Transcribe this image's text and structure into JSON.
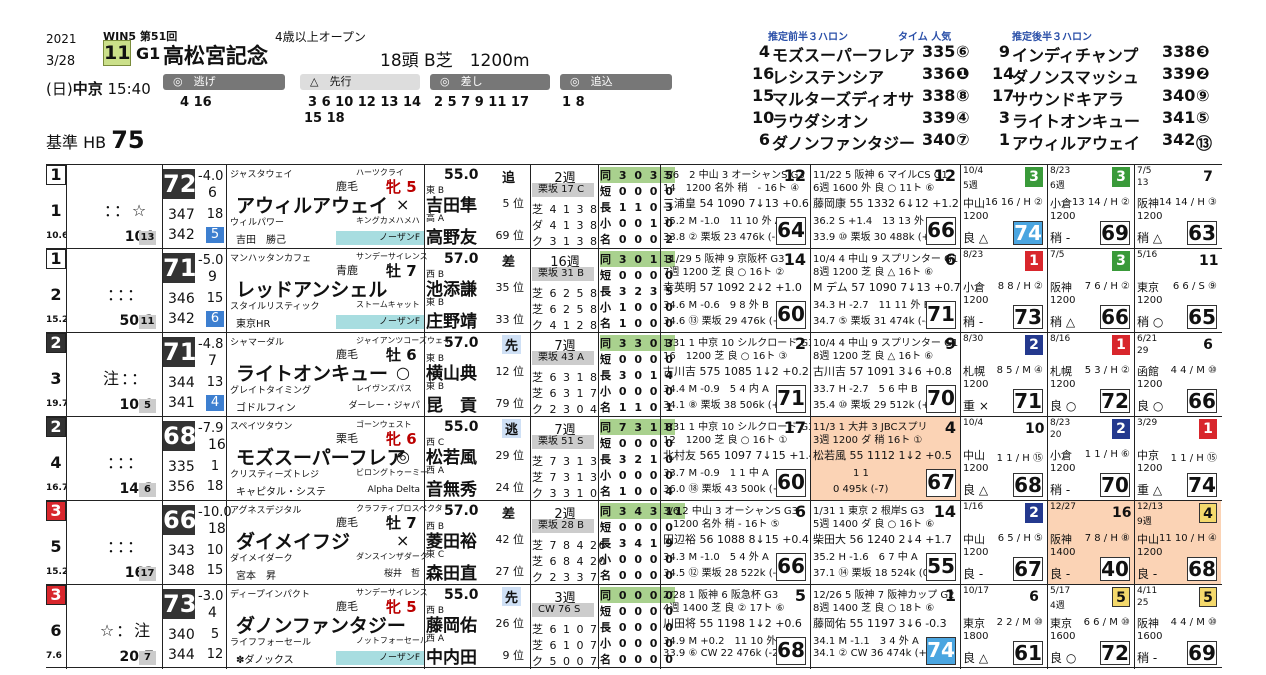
{
  "header": {
    "year": "2021",
    "date": "3/28",
    "day": "(日)",
    "venue": "中京",
    "time": "15:40",
    "race_no": "11",
    "grade": "G1",
    "race_name": "高松宮記念",
    "win5": "WIN5 第51回",
    "condition": "4歳以上オープン",
    "field": "18頭 B芝　1200m",
    "pace": [
      {
        "label": "逃げ",
        "horses": "4 16"
      },
      {
        "label": "先行",
        "horses": "3 6 10 12 13 14"
      },
      {
        "label": "先行2",
        "horses": "15 18"
      },
      {
        "label": "差し",
        "horses": "2 5 7 9 11 17"
      },
      {
        "label": "追込",
        "horses": "1 8"
      }
    ],
    "kijun_label": "基準 HB",
    "kijun_value": "75"
  },
  "predictions": {
    "front_hd": "推定前半３ハロン",
    "time_hd": "タイム 人気",
    "back_hd": "推定後半３ハロン",
    "front": [
      {
        "no": "4",
        "name": "モズスーパーフレア",
        "time": "335",
        "rank": "⑥"
      },
      {
        "no": "16",
        "name": "レシステンシア",
        "time": "336",
        "rank": "❶"
      },
      {
        "no": "15",
        "name": "マルターズディオサ",
        "time": "338",
        "rank": "⑧"
      },
      {
        "no": "10",
        "name": "ラウダシオン",
        "time": "339",
        "rank": "④"
      },
      {
        "no": "6",
        "name": "ダノンファンタジー",
        "time": "340",
        "rank": "⑦"
      }
    ],
    "back": [
      {
        "no": "9",
        "name": "インディチャンプ",
        "time": "338",
        "rank": "❸"
      },
      {
        "no": "14",
        "name": "ダノンスマッシュ",
        "time": "339",
        "rank": "❷"
      },
      {
        "no": "17",
        "name": "サウンドキアラ",
        "time": "340",
        "rank": "⑨"
      },
      {
        "no": "3",
        "name": "ライトオンキュー",
        "time": "341",
        "rank": "⑤"
      },
      {
        "no": "1",
        "name": "アウィルアウェイ",
        "time": "342",
        "rank": "⑬"
      }
    ]
  },
  "horses": [
    {
      "frame": "1",
      "num": "1",
      "odds_rank": "10.6",
      "marks": "：：☆",
      "odds": "104",
      "ninki": "13",
      "rating": "72",
      "rdiff": "-4.0",
      "rk": "6",
      "idx": [
        {
          "v": "347",
          "r": "18"
        },
        {
          "v": "342",
          "r": "5"
        }
      ],
      "sire": "ジャスタウェイ",
      "siresire": "ハーツクライ",
      "trainer": "鹿毛",
      "sex": "牝 5",
      "name": "アウィルアウェイ",
      "mark": "×",
      "dam": "ウィルパワー",
      "damsire": "キングカメハメハ",
      "owner": "吉田　勝己",
      "breeder": "ノーザンF",
      "wt": "55.0",
      "style": "追",
      "j1": "東 B",
      "jname1": "吉田隼",
      "jpos1": "5 位",
      "j2": "高 A",
      "jname2": "高野友",
      "jpos2": "69 位",
      "tr": "2週",
      "trbox": "栗坂 17 C",
      "tl1": "芝 4 1 3 8",
      "tl2": "ダ 4 1 3 8",
      "tl3": "ク 3 1 3 8",
      "st": [
        "同 3 0 3 5",
        "短 0 0 0 0",
        "長 1 1 0 3",
        "小 0 0 1 0",
        "名 0 0 0 2"
      ],
      "pr": [
        {
          "peach": false,
          "t1": "3/6　2 中山 3 オーシャンS G3",
          "fin": "12",
          "t2": "14　1200 名外 稍　- 16ト ④",
          "t3": "三浦皇 54 1090 7↓13 +0.6",
          "t4": "35.2 M -1.0　11 10 外 A",
          "t5": "33.8 ② 栗坂 23 476k (-12)",
          "tail": "64",
          "blue": false
        },
        {
          "peach": false,
          "t1": "11/22 5 阪神 6 マイルCS G1",
          "fin": "12",
          "t2": "6週 1600 外 良 ○ 11ト ⑥",
          "t3": "藤岡康 55 1332 6↓12 +1.2",
          "t4": "36.2 S +1.4　13 13 外 B",
          "t5": "33.9 ⑩ 栗坂 30 488k (+10)",
          "tail": "66",
          "blue": false
        }
      ],
      "sp": [
        {
          "d": "10/4",
          "f": "3",
          "fc": "green",
          "c": "5週",
          "v": "中山",
          "dist": "1200",
          "pos": "16 16 / H ②",
          "g": "良 △",
          "box": "74",
          "blue": true,
          "peach": false
        },
        {
          "d": "8/23",
          "f": "3",
          "fc": "green",
          "c": "6週",
          "v": "小倉",
          "dist": "1200",
          "pos": "13 14 / H ②",
          "g": "稍 -",
          "box": "69",
          "blue": false,
          "peach": false
        },
        {
          "d": "7/5",
          "f": "7",
          "fc": "plain",
          "c": "13",
          "v": "阪神",
          "dist": "1200",
          "pos": "14 14 / H ③",
          "g": "稍 △",
          "box": "63",
          "blue": false,
          "peach": false
        }
      ]
    },
    {
      "frame": "1",
      "num": "2",
      "odds_rank": "15.2",
      "marks": "：：：",
      "odds": "50.1",
      "ninki": "11",
      "rating": "71",
      "rdiff": "-5.0",
      "rk": "9",
      "idx": [
        {
          "v": "346",
          "r": "15"
        },
        {
          "v": "342",
          "r": "6"
        }
      ],
      "sire": "マンハッタンカフェ",
      "siresire": "サンデーサイレンス",
      "trainer": "青鹿",
      "sex": "牡 7",
      "name": "レッドアンシェル",
      "mark": "",
      "dam": "スタイルリスティック",
      "damsire": "ストームキャット",
      "owner": "東京HR",
      "breeder": "ノーザンF",
      "wt": "57.0",
      "style": "差",
      "j1": "西 B",
      "jname1": "池添謙",
      "jpos1": "35 位",
      "j2": "東 B",
      "jname2": "庄野靖",
      "jpos2": "33 位",
      "tr": "16週",
      "trbox": "栗坂 31 B",
      "tl1": "芝 6 2 5 8",
      "tl2": "芝 6 2 5 8",
      "tl3": "ク 4 1 2 8",
      "st": [
        "同 3 0 1 3",
        "短 0 0 0 0",
        "長 3 2 3 5",
        "小 1 0 0 0",
        "名 1 0 0 0"
      ],
      "pr": [
        {
          "peach": false,
          "t1": "11/29 5 阪神 9 京阪杯 G3",
          "fin": "14",
          "t2": "7週 1200 芝 良 ○ 16ト ②",
          "t3": "幸英明 57 1092 2↓2 +1.0",
          "t4": "34.6 M -0.6　9 8 外 B",
          "t5": "34.6 ⑬ 栗坂 29 476k (+2)",
          "tail": "60",
          "blue": false
        },
        {
          "peach": false,
          "t1": "10/4 4 中山 9 スプリンター G1",
          "fin": "6",
          "t2": "8週 1200 芝 良 △ 16ト ⑥",
          "t3": "M デム 57 1090 7↓13 +0.7",
          "t4": "34.3 H -2.7　11 11 外 B",
          "t5": "34.7 ⑤ 栗坂 31 474k (-4)",
          "tail": "71",
          "blue": false
        }
      ],
      "sp": [
        {
          "d": "8/23",
          "f": "1",
          "fc": "red",
          "c": "",
          "v": "小倉",
          "dist": "1200",
          "pos": "8 8 / H ②",
          "g": "稍 -",
          "box": "73",
          "blue": false,
          "peach": false
        },
        {
          "d": "7/5",
          "f": "3",
          "fc": "green",
          "c": "",
          "v": "阪神",
          "dist": "1200",
          "pos": "7 6 / H ②",
          "g": "稍 △",
          "box": "66",
          "blue": false,
          "peach": false
        },
        {
          "d": "5/16",
          "f": "11",
          "fc": "plain",
          "c": "",
          "v": "東京",
          "dist": "1200",
          "pos": "6 6 / S ⑨",
          "g": "稍 ○",
          "box": "65",
          "blue": false,
          "peach": false
        }
      ]
    },
    {
      "frame": "2",
      "num": "3",
      "odds_rank": "19.7",
      "marks": "注：：",
      "odds": "10.0",
      "ninki": "5",
      "rating": "71",
      "rdiff": "-4.8",
      "rk": "7",
      "idx": [
        {
          "v": "344",
          "r": "13"
        },
        {
          "v": "341",
          "r": "4"
        }
      ],
      "sire": "シャマーダル",
      "siresire": "ジャイアンツコーズウェイ",
      "trainer": "鹿毛",
      "sex": "牡 6",
      "name": "ライトオンキュー",
      "mark": "○",
      "dam": "グレイトタイミング",
      "damsire": "レイヴンズパス",
      "owner": "ゴドルフィン",
      "breeder": "ダーレー・ジャパ",
      "wt": "57.0",
      "style": "先",
      "j1": "東 B",
      "jname1": "横山典",
      "jpos1": "12 位",
      "j2": "東 B",
      "jname2": "昆　貢",
      "jpos2": "79 位",
      "tr": "7週",
      "trbox": "栗坂 43 A",
      "tl1": "芝 6 3 1 8",
      "tl2": "芝 6 3 1 7",
      "tl3": "ク 2 3 0 4",
      "st": [
        "同 3 3 0 3",
        "短 0 0 0 0",
        "長 3 0 1 4",
        "小 0 0 0 0",
        "名 1 1 0 1"
      ],
      "pr": [
        {
          "peach": false,
          "t1": "1/31 1 中京 10 シルクロード G3",
          "fin": "2",
          "t2": "16　1200 芝 良 ○ 16ト ③",
          "t3": "古川吉 575 1085 1↓2 +0.2",
          "t4": "34.4 M -0.9　5 4 内 A",
          "t5": "34.1 ⑧ 栗坂 38 506k (+6)",
          "tail": "71",
          "blue": false
        },
        {
          "peach": false,
          "t1": "10/4 4 中山 9 スプリンター G1",
          "fin": "9",
          "t2": "8週 1200 芝 良 △ 16ト ⑥",
          "t3": "古川吉 57 1091 3↓6 +0.8",
          "t4": "33.7 H -2.7　5 6 中 B",
          "t5": "35.4 ⑩ 栗坂 29 512k (+6)",
          "tail": "70",
          "blue": false
        }
      ],
      "sp": [
        {
          "d": "8/30",
          "f": "2",
          "fc": "navy",
          "c": "",
          "v": "札幌",
          "dist": "1200",
          "pos": "8 5 / M ④",
          "g": "重 ×",
          "box": "71",
          "blue": false,
          "peach": false
        },
        {
          "d": "8/16",
          "f": "1",
          "fc": "red",
          "c": "",
          "v": "札幌",
          "dist": "1200",
          "pos": "5 3 / H ②",
          "g": "良 ○",
          "box": "72",
          "blue": false,
          "peach": false
        },
        {
          "d": "6/21",
          "f": "6",
          "fc": "plain",
          "c": "29",
          "v": "函館",
          "dist": "1200",
          "pos": "4 4 / M ⑩",
          "g": "良 ○",
          "box": "66",
          "blue": false,
          "peach": false
        }
      ]
    },
    {
      "frame": "2",
      "num": "4",
      "odds_rank": "16.7",
      "marks": "：：：",
      "odds": "14.3",
      "ninki": "6",
      "rating": "68",
      "rdiff": "-7.9",
      "rk": "16",
      "idx": [
        {
          "v": "335",
          "r": "1"
        },
        {
          "v": "356",
          "r": "18"
        }
      ],
      "sire": "スペイツタウン",
      "siresire": "ゴーンウェスト",
      "trainer": "栗毛",
      "sex": "牝 6",
      "name": "モズスーパーフレア",
      "mark": "◎",
      "dam": "クリスティーズトレジ",
      "damsire": "ビロングトゥーミー",
      "owner": "キャピタル・システ",
      "breeder": "Alpha Delta",
      "wt": "55.0",
      "style": "逃",
      "j1": "西 C",
      "jname1": "松若風",
      "jpos1": "29 位",
      "j2": "西 A",
      "jname2": "音無秀",
      "jpos2": "24 位",
      "tr": "7週",
      "trbox": "栗坂 51 S",
      "tl1": "芝 7 3 1 3",
      "tl2": "芝 7 3 1 3",
      "tl3": "ク 3 3 1 0",
      "st": [
        "同 7 3 1 8",
        "短 0 0 0 0",
        "長 3 2 1 0",
        "小 0 0 0 0",
        "名 1 0 0 4"
      ],
      "pr": [
        {
          "peach": false,
          "t1": "1/31 1 中京 10 シルクロード G3",
          "fin": "17",
          "t2": "12　1200 芝 良 ○ 16ト ①",
          "t3": "北村友 565 1097 7↓15 +1.4",
          "t4": "33.7 M -0.9　1 1 中 A",
          "t5": "36.0 ⑱ 栗坂 43 500k (+6)",
          "tail": "60",
          "blue": false
        },
        {
          "peach": true,
          "t1": "11/3 1 大井 3 JBCスプリ",
          "fin": "4",
          "t2": "3週 1200 ダ 稍 16ト ①",
          "t3": "松若風 55 1112 1↓2 +0.5",
          "t4": "　　　　1 1",
          "t5": "　　0 495k (-7)",
          "tail": "67",
          "blue": false
        }
      ],
      "sp": [
        {
          "d": "10/4",
          "f": "10",
          "fc": "plain",
          "c": "",
          "v": "中山",
          "dist": "1200",
          "pos": "1 1 / H ⑮",
          "g": "良 △",
          "box": "68",
          "blue": false,
          "peach": false
        },
        {
          "d": "8/23",
          "f": "2",
          "fc": "navy",
          "c": "20",
          "v": "小倉",
          "dist": "1200",
          "pos": "1 1 / H ⑥",
          "g": "稍 -",
          "box": "70",
          "blue": false,
          "peach": false
        },
        {
          "d": "3/29",
          "f": "1",
          "fc": "red",
          "c": "",
          "v": "中京",
          "dist": "1200",
          "pos": "1 1 / H ⑮",
          "g": "重 △",
          "box": "74",
          "blue": false,
          "peach": false
        }
      ]
    },
    {
      "frame": "3",
      "num": "5",
      "odds_rank": "15.2",
      "marks": "：：：",
      "odds": "163",
      "ninki": "17",
      "rating": "66",
      "rdiff": "-10.0",
      "rk": "18",
      "idx": [
        {
          "v": "343",
          "r": "10"
        },
        {
          "v": "348",
          "r": "15"
        }
      ],
      "sire": "アグネスデジタル",
      "siresire": "クラフティプロスペクタ",
      "trainer": "鹿毛",
      "sex": "牡 7",
      "name": "ダイメイフジ",
      "mark": "×",
      "dam": "ダイメイダーク",
      "damsire": "ダンスインザダーク",
      "owner": "宮本　昇",
      "breeder": "桜井　哲",
      "wt": "57.0",
      "style": "差",
      "j1": "西 B",
      "jname1": "菱田裕",
      "jpos1": "42 位",
      "j2": "東 C",
      "jname2": "森田直",
      "jpos2": "27 位",
      "tr": "2週",
      "trbox": "栗坂 28 B",
      "tl1": "芝 7 8 4 26",
      "tl2": "芝 6 8 4 20",
      "tl3": "ク 2 3 3 7",
      "st": [
        "同 3 4 3 11",
        "短 0 0 0 0",
        "長 3 4 1 9",
        "小 0 0 0 0",
        "名 0 0 0 0"
      ],
      "pr": [
        {
          "peach": false,
          "t1": "3/6 2 中山 3 オーシャンS G3",
          "fin": "6",
          "t2": "　1200 名外 稍 - 16ト ⑤",
          "t3": "田辺裕 56 1088 8↓15 +0.4",
          "t4": "34.3 M -1.0　5 4 外 A",
          "t5": "34.5 ⑫ 栗坂 28 522k (-2)",
          "tail": "66",
          "blue": false
        },
        {
          "peach": false,
          "t1": "1/31 1 東京 2 根岸S G3",
          "fin": "14",
          "t2": "5週 1400 ダ 良 ○ 16ト ⑥",
          "t3": "柴田大 56 1240 2↓4 +1.7",
          "t4": "35.2 H -1.6　6 7 中 A",
          "t5": "37.1 ⑭ 栗坂 18 524k (0)",
          "tail": "55",
          "blue": false
        }
      ],
      "sp": [
        {
          "d": "1/16",
          "f": "2",
          "fc": "navy",
          "c": "",
          "v": "中山",
          "dist": "1200",
          "pos": "6 5 / H ⑤",
          "g": "良 -",
          "box": "67",
          "blue": false,
          "peach": false
        },
        {
          "d": "12/27",
          "f": "16",
          "fc": "plain",
          "c": "",
          "v": "阪神",
          "dist": "1400",
          "pos": "7 8 / H ⑧",
          "g": "良 -",
          "box": "40",
          "blue": false,
          "peach": true
        },
        {
          "d": "12/13",
          "f": "4",
          "fc": "yel",
          "c": "9週",
          "v": "中山",
          "dist": "1200",
          "pos": "11 10 / H ④",
          "g": "良 -",
          "box": "68",
          "blue": false,
          "peach": true
        }
      ]
    },
    {
      "frame": "3",
      "num": "6",
      "odds_rank": "7.6",
      "marks": "☆：注",
      "odds": "20.7",
      "ninki": "7",
      "rating": "73",
      "rdiff": "-3.0",
      "rk": "4",
      "idx": [
        {
          "v": "340",
          "r": "5"
        },
        {
          "v": "344",
          "r": "12"
        }
      ],
      "sire": "ディープインパクト",
      "siresire": "サンデーサイレンス",
      "trainer": "鹿毛",
      "sex": "牝 5",
      "name": "ダノンファンタジー",
      "mark": "",
      "dam": "ライフフォーセール",
      "damsire": "ノットフォーセール",
      "owner": "✽ダノックス",
      "breeder": "ノーザンF",
      "wt": "55.0",
      "style": "先",
      "j1": "西 B",
      "jname1": "藤岡佑",
      "jpos1": "26 位",
      "j2": "西 A ",
      "jname2": "中内田",
      "jpos2": "9 位",
      "tr": "3週",
      "trbox": "CW 76 S",
      "tl1": "芝 6 1 0 7",
      "tl2": "芝 6 1 0 7",
      "tl3": "ク 5 0 0 7",
      "st": [
        "同 0 0 0 0",
        "短 0 0 0 0",
        "長 0 0 0 0",
        "小 0 0 0 0",
        "名 0 0 0 0"
      ],
      "pr": [
        {
          "peach": false,
          "t1": "2/28 1 阪神 6 阪急杯 G3",
          "fin": "5",
          "t2": "4週 1400 芝 良 ② 17ト ⑥",
          "t3": "川田将 55 1198 1↓2 +0.6",
          "t4": "34.9 M +0.2　11 10 外 S",
          "t5": "33.9 ⑥ CW 22 476k (-2)",
          "tail": "68",
          "blue": false
        },
        {
          "peach": false,
          "t1": "12/26 5 阪神 7 阪神カップ G2",
          "fin": "1",
          "t2": "8週 1400 芝 良 ○ 18ト ⑥",
          "t3": "藤岡佑 55 1197 3↓6 -0.3",
          "t4": "34.1 M -1.1　3 4 外 A",
          "t5": "34.1 ② CW 36 474k (+2)",
          "tail": "74",
          "blue": true
        }
      ],
      "sp": [
        {
          "d": "10/17",
          "f": "6",
          "fc": "plain",
          "c": "",
          "v": "東京",
          "dist": "1800",
          "pos": "2 2 / M ⑩",
          "g": "良 △",
          "box": "61",
          "blue": false,
          "peach": false
        },
        {
          "d": "5/17",
          "f": "5",
          "fc": "yel",
          "c": "4週",
          "v": "東京",
          "dist": "1600",
          "pos": "6 6 / M ⑩",
          "g": "良 ○",
          "box": "72",
          "blue": false,
          "peach": false
        },
        {
          "d": "4/11",
          "f": "5",
          "fc": "yel",
          "c": "25",
          "v": "阪神",
          "dist": "1600",
          "pos": "4 4 / M ⑩",
          "g": "稍 -",
          "box": "69",
          "blue": false,
          "peach": false
        }
      ]
    }
  ]
}
